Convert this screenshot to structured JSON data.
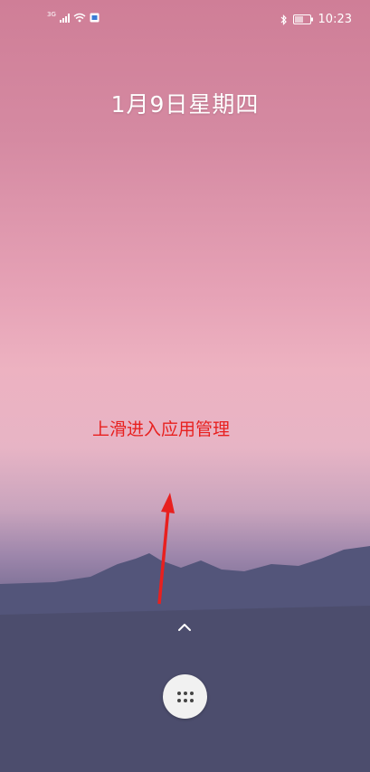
{
  "status_bar": {
    "network_type": "3G",
    "time": "10:23",
    "icons": [
      "signal-icon",
      "wifi-icon",
      "notification-icon",
      "bluetooth-icon",
      "battery-icon"
    ]
  },
  "lockscreen": {
    "date": "1月9日星期四"
  },
  "annotation": {
    "text": "上滑进入应用管理",
    "color": "#e8201f"
  },
  "controls": {
    "swipe_up_icon": "chevron-up-icon",
    "app_drawer_icon": "grid-dots-icon"
  }
}
